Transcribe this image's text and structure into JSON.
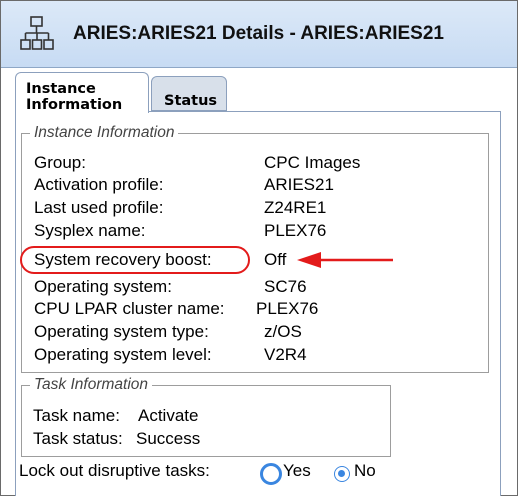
{
  "window": {
    "title": "ARIES:ARIES21 Details - ARIES:ARIES21",
    "icon": "network-tree-icon"
  },
  "tabs": [
    {
      "label_line1": "Instance",
      "label_line2": "Information",
      "active": true
    },
    {
      "label": "Status",
      "active": false
    }
  ],
  "instance_information": {
    "legend": "Instance Information",
    "rows": [
      {
        "label": "Group:",
        "value": "CPC Images"
      },
      {
        "label": "Activation profile:",
        "value": "ARIES21"
      },
      {
        "label": "Last used profile:",
        "value": "Z24RE1"
      },
      {
        "label": "Sysplex name:",
        "value": "PLEX76"
      },
      {
        "label": "System recovery boost:",
        "value": "Off"
      },
      {
        "label": "Operating system:",
        "value": "SC76"
      },
      {
        "label": "CPU LPAR cluster name:",
        "value": "PLEX76"
      },
      {
        "label": "Operating system type:",
        "value": "z/OS"
      },
      {
        "label": "Operating system level:",
        "value": "V2R4"
      }
    ]
  },
  "task_information": {
    "legend": "Task Information",
    "rows": [
      {
        "label": "Task name:",
        "value": "Activate"
      },
      {
        "label": "Task status:",
        "value": "Success"
      }
    ]
  },
  "lock_out": {
    "label": "Lock out disruptive tasks:",
    "options": [
      {
        "label": "Yes",
        "selected": false
      },
      {
        "label": "No",
        "selected": true
      }
    ]
  },
  "colors": {
    "titlebar": "#c7dbf3",
    "annotation": "#e31b1b",
    "radio_accent": "#3a86e0"
  }
}
